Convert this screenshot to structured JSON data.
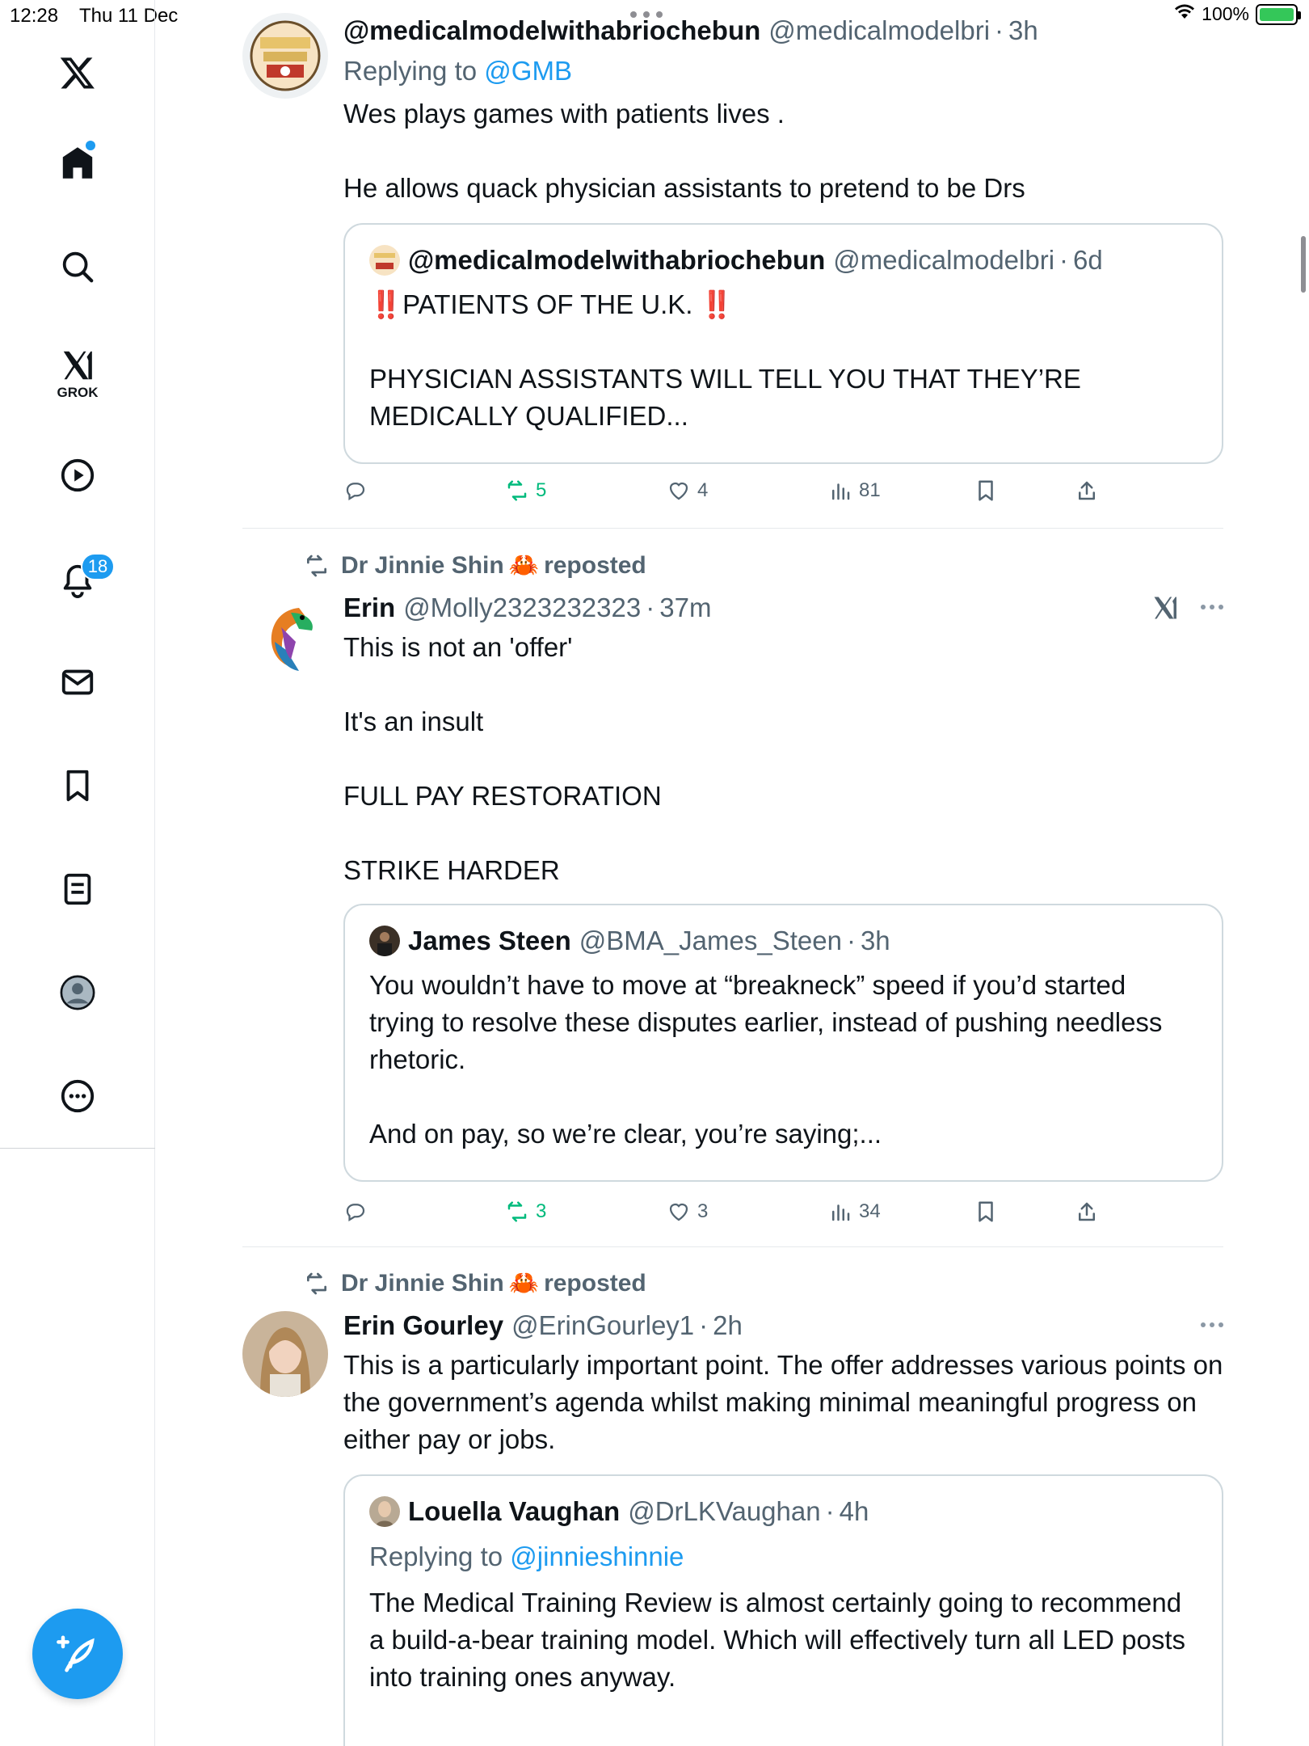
{
  "status_bar": {
    "time": "12:28",
    "date": "Thu 11 Dec",
    "battery": "100%"
  },
  "sidebar": {
    "grok_label": "GROK",
    "notifications_badge": "18",
    "items": [
      "x-logo",
      "home",
      "search",
      "grok",
      "video",
      "notifications",
      "messages",
      "bookmarks",
      "lists",
      "profile",
      "more"
    ]
  },
  "posts": [
    {
      "name": "@medicalmodelwithabriochebun",
      "handle": "@medicalmodelbri",
      "time": "3h",
      "reply_prefix": "Replying to",
      "reply_to": "@GMB",
      "text": "Wes plays games with patients lives .\n\nHe allows quack physician assistants to pretend to be Drs",
      "quote": {
        "name": "@medicalmodelwithabriochebun",
        "handle": "@medicalmodelbri",
        "time": "6d",
        "text": "‼️PATIENTS OF THE U.K. ‼️\n\nPHYSICIAN ASSISTANTS WILL TELL YOU THAT THEY’RE MEDICALLY QUALIFIED..."
      },
      "actions": {
        "reposts": "5",
        "likes": "4",
        "views": "81"
      }
    },
    {
      "reposted_by": "Dr Jinnie Shin",
      "reposted_emoji": "🦀",
      "reposted_label": "reposted",
      "name": "Erin",
      "handle": "@Molly2323232323",
      "time": "37m",
      "text": "This is not an 'offer'\n\nIt's an insult\n\nFULL PAY RESTORATION\n\nSTRIKE HARDER",
      "quote": {
        "name": "James Steen",
        "handle": "@BMA_James_Steen",
        "time": "3h",
        "text": "You wouldn’t have to move at “breakneck” speed if you’d started trying to resolve these disputes earlier, instead of pushing needless rhetoric.\n\nAnd on pay, so we’re clear, you’re saying;..."
      },
      "actions": {
        "reposts": "3",
        "likes": "3",
        "views": "34"
      }
    },
    {
      "reposted_by": "Dr Jinnie Shin",
      "reposted_emoji": "🦀",
      "reposted_label": "reposted",
      "name": "Erin Gourley",
      "handle": "@ErinGourley1",
      "time": "2h",
      "text": "This is a particularly important point. The offer addresses various points on the government’s agenda whilst making minimal meaningful progress on either pay or jobs.",
      "quote": {
        "name": "Louella Vaughan",
        "handle": "@DrLKVaughan",
        "time": "4h",
        "reply_prefix": "Replying to",
        "reply_to": "@jinnieshinnie",
        "text": "The Medical Training Review is almost certainly going to recommend a build-a-bear training model. Which will effectively turn all LED posts into training ones anyway."
      }
    }
  ],
  "colors": {
    "accent": "#1d9bf0",
    "repost_green": "#00ba7c",
    "secondary_text": "#536471",
    "border": "#cfd9de"
  }
}
